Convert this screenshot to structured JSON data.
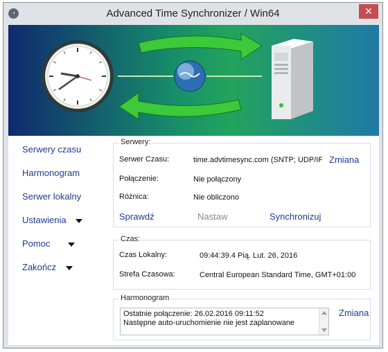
{
  "window": {
    "title": "Advanced Time Synchronizer / Win64",
    "close_symbol": "✕"
  },
  "nav": {
    "items": [
      {
        "label": "Serwery czasu",
        "has_menu": false
      },
      {
        "label": "Harmonogram",
        "has_menu": false
      },
      {
        "label": "Serwer lokalny",
        "has_menu": false
      },
      {
        "label": "Ustawienia",
        "has_menu": true
      },
      {
        "label": "Pomoc",
        "has_menu": true
      },
      {
        "label": "Zakończ",
        "has_menu": true
      }
    ]
  },
  "servers": {
    "title": "Serwery:",
    "server_label": "Serwer Czasu:",
    "server_value": "time.advtimesync.com (SNTP; UDP/IF",
    "change_label": "Zmiana",
    "connection_label": "Połączenie:",
    "connection_value": "Nie połączony",
    "difference_label": "Różnica:",
    "difference_value": "Nie obliczono",
    "check_label": "Sprawdź",
    "set_label": "Nastaw",
    "sync_label": "Synchronizuj"
  },
  "time": {
    "title": "Czas:",
    "local_label": "Czas Lokalny:",
    "local_value": "09:44:39.4 Pią. Lut. 26, 2016",
    "zone_label": "Strefa Czasowa:",
    "zone_value": "Central European Standard Time, GMT+01:00"
  },
  "schedule": {
    "title": "Harmonogram",
    "log_lines": [
      "Ostatnie połączenie: 26.02.2016 09:11:52",
      "Następne auto-uruchomienie nie jest zaplanowane"
    ],
    "change_label": "Zmiana"
  },
  "icons": {
    "app": "app-clock-icon",
    "banner_clock": "wall-clock-icon",
    "banner_globe": "globe-icon",
    "banner_server": "server-tower-icon",
    "banner_arrows": "sync-arrows-icon"
  },
  "colors": {
    "link": "#1f3a93",
    "disabled": "#8a8a8a",
    "close": "#c74b50"
  }
}
